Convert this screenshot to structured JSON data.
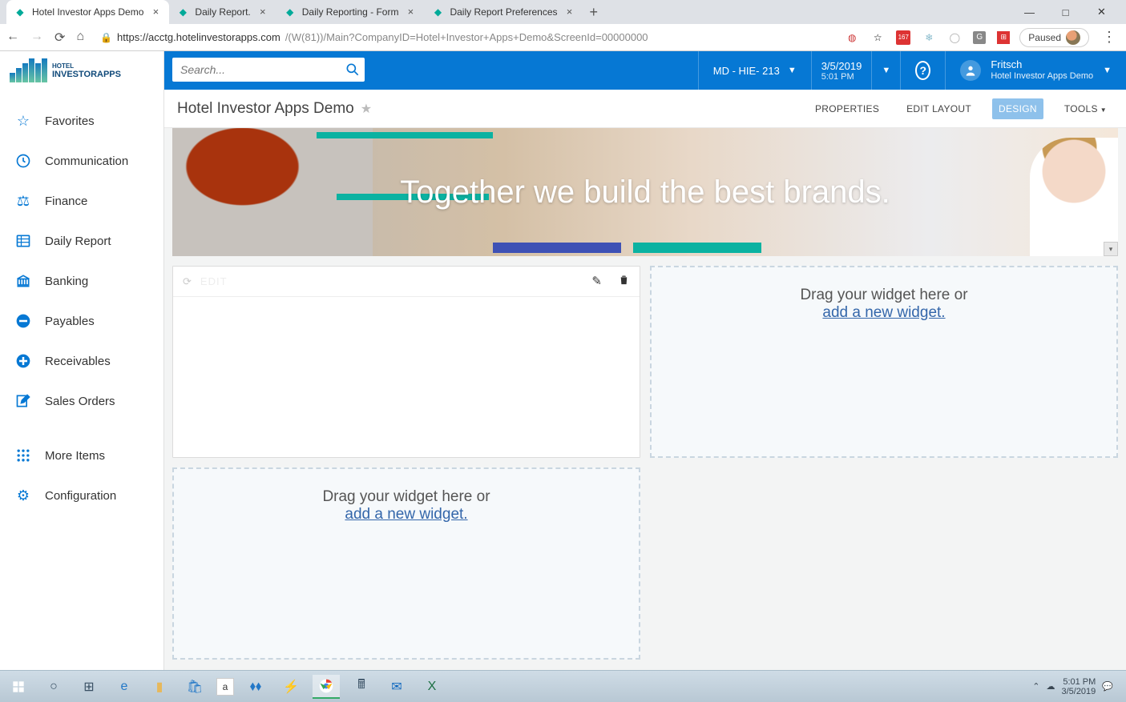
{
  "browser": {
    "tabs": [
      {
        "label": "Hotel Investor Apps Demo",
        "active": true
      },
      {
        "label": "Daily Report.",
        "active": false
      },
      {
        "label": "Daily Reporting - Form",
        "active": false
      },
      {
        "label": "Daily Report Preferences",
        "active": false
      }
    ],
    "url_host": "https://acctg.hotelinvestorapps.com",
    "url_path": "/(W(81))/Main?CompanyID=Hotel+Investor+Apps+Demo&ScreenId=00000000",
    "paused_label": "Paused",
    "ext_badge": "167"
  },
  "header": {
    "search_placeholder": "Search...",
    "company_selector": "MD - HIE- 213",
    "date": "3/5/2019",
    "time": "5:01 PM",
    "user_name": "Fritsch",
    "user_company": "Hotel Investor Apps Demo",
    "logo_line1": "HOTEL",
    "logo_line2": "INVESTORAPPS"
  },
  "sidebar": {
    "items": [
      {
        "label": "Favorites",
        "icon": "star"
      },
      {
        "label": "Communication",
        "icon": "clock"
      },
      {
        "label": "Finance",
        "icon": "scale"
      },
      {
        "label": "Daily Report",
        "icon": "grid"
      },
      {
        "label": "Banking",
        "icon": "bank"
      },
      {
        "label": "Payables",
        "icon": "minus"
      },
      {
        "label": "Receivables",
        "icon": "plus"
      },
      {
        "label": "Sales Orders",
        "icon": "edit"
      },
      {
        "label": "More Items",
        "icon": "dots"
      },
      {
        "label": "Configuration",
        "icon": "gear"
      }
    ]
  },
  "page": {
    "title": "Hotel Investor Apps Demo",
    "tools": [
      {
        "label": "PROPERTIES",
        "active": false
      },
      {
        "label": "EDIT LAYOUT",
        "active": false
      },
      {
        "label": "DESIGN",
        "active": true
      },
      {
        "label": "TOOLS",
        "active": false,
        "dropdown": true
      }
    ],
    "hero_text": "Together we build the best brands.",
    "widget_placeholder_text": "Drag your widget here or",
    "widget_add_link": "add a new widget.",
    "widget_edit_faded": "EDIT"
  },
  "taskbar": {
    "time": "5:01 PM",
    "date": "3/5/2019"
  }
}
